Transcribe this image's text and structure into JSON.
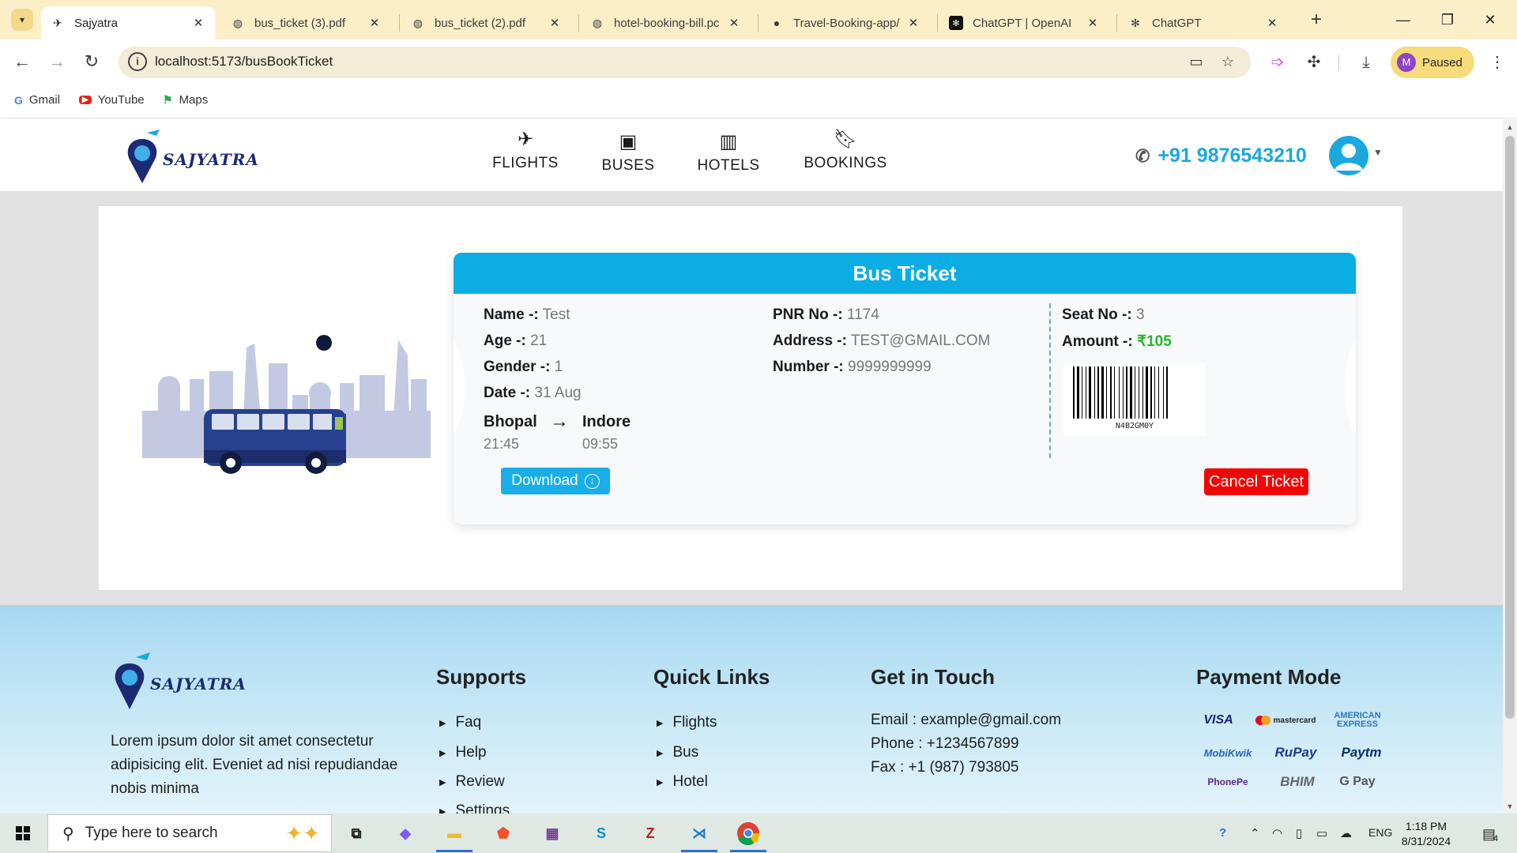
{
  "browser": {
    "tabs": [
      {
        "title": "Sajyatra",
        "icon": "plane-favicon",
        "active": true
      },
      {
        "title": "bus_ticket (3).pdf",
        "icon": "globe-icon",
        "active": false
      },
      {
        "title": "bus_ticket (2).pdf",
        "icon": "globe-icon",
        "active": false
      },
      {
        "title": "hotel-booking-bill.pc",
        "icon": "globe-icon",
        "active": false
      },
      {
        "title": "Travel-Booking-app/",
        "icon": "github-icon",
        "active": false
      },
      {
        "title": "ChatGPT | OpenAI",
        "icon": "openai-icon",
        "active": false
      },
      {
        "title": "ChatGPT",
        "icon": "openai-icon",
        "active": false
      }
    ],
    "url": "localhost:5173/busBookTicket",
    "profile": {
      "initial": "M",
      "status": "Paused"
    },
    "bookmarks": [
      {
        "label": "Gmail",
        "icon": "gmail-icon"
      },
      {
        "label": "YouTube",
        "icon": "youtube-icon"
      },
      {
        "label": "Maps",
        "icon": "maps-icon"
      }
    ]
  },
  "header": {
    "logo": "SAJYATRA",
    "nav": [
      {
        "label": "FLIGHTS",
        "icon": "plane-icon"
      },
      {
        "label": "BUSES",
        "icon": "bus-icon"
      },
      {
        "label": "HOTELS",
        "icon": "hotel-icon"
      },
      {
        "label": "BOOKINGS",
        "icon": "bookmark-icon"
      }
    ],
    "phone": "+91 9876543210"
  },
  "ticket": {
    "title": "Bus Ticket",
    "col1": [
      {
        "key": "Name -:",
        "value": " Test"
      },
      {
        "key": "Age -:",
        "value": " 21"
      },
      {
        "key": "Gender -:",
        "value": " 1"
      },
      {
        "key": "Date -:",
        "value": " 31 Aug"
      }
    ],
    "col2": [
      {
        "key": "PNR No -:",
        "value": " 1174"
      },
      {
        "key": "Address -:",
        "value": " TEST@GMAIL.COM"
      },
      {
        "key": "Number -:",
        "value": " 9999999999"
      }
    ],
    "seat": {
      "key": "Seat No -:",
      "value": " 3"
    },
    "amount": {
      "key": "Amount -:",
      "value": " ₹105"
    },
    "from": {
      "city": "Bhopal",
      "time": "21:45"
    },
    "to": {
      "city": "Indore",
      "time": "09:55"
    },
    "barcode_text": "N4B2GM0Y",
    "download_label": "Download",
    "cancel_label": "Cancel Ticket",
    "colors": {
      "header": "#0aaee4",
      "amount": "#21b826",
      "cancel": "#f40404"
    }
  },
  "footer": {
    "logo": "SAJYATRA",
    "about": "Lorem ipsum dolor sit amet consectetur adipisicing elit. Eveniet ad nisi repudiandae nobis minima",
    "supports": {
      "heading": "Supports",
      "links": [
        "Faq",
        "Help",
        "Review",
        "Settings"
      ]
    },
    "quick_links": {
      "heading": "Quick Links",
      "links": [
        "Flights",
        "Bus",
        "Hotel"
      ]
    },
    "contact": {
      "heading": "Get in Touch",
      "email": "Email : example@gmail.com",
      "phone": "Phone : +1234567899",
      "fax": "Fax : +1 (987) 793805"
    },
    "payment": {
      "heading": "Payment Mode",
      "methods": [
        "VISA",
        "mastercard",
        "AMERICAN EXPRESS",
        "MobiKwik",
        "RuPay",
        "Paytm",
        "PhonePe",
        "BHIM",
        "G Pay"
      ]
    }
  },
  "taskbar": {
    "search_placeholder": "Type here to search",
    "language": "ENG",
    "time": "1:18 PM",
    "date": "8/31/2024",
    "notifications": "4"
  }
}
